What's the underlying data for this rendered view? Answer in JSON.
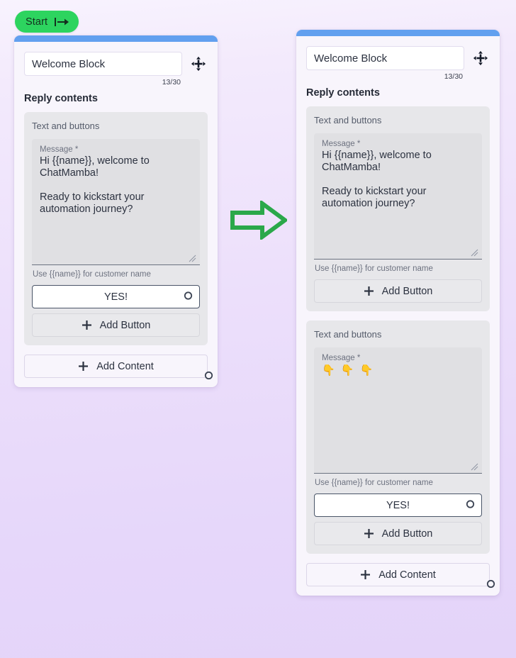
{
  "canvas": {
    "background_top": "#f8f3fe",
    "background_bottom": "#e4d4f9",
    "accent_blue": "#62a0ef",
    "accent_green": "#2dd45f"
  },
  "start_node": {
    "label": "Start",
    "icon": "flow-start-arrow-icon"
  },
  "flow_arrow": {
    "icon": "right-arrow-icon",
    "color": "#2aa84a"
  },
  "nodes": [
    {
      "id": "before",
      "title_value": "Welcome Block",
      "title_placeholder": "Block name",
      "char_count": "13/30",
      "section_title": "Reply contents",
      "move_icon": "move-handle-icon",
      "blocks": [
        {
          "block_title": "Text and buttons",
          "message_label": "Message *",
          "message_value": "Hi {{name}}, welcome to ChatMamba!\n\nReady to kickstart your automation journey?",
          "message_is_emoji": false,
          "helper_text": "Use {{name}} for customer name",
          "reply_buttons": [
            {
              "label": "YES!"
            }
          ],
          "add_button_label": "Add Button"
        }
      ],
      "add_content_label": "Add Content"
    },
    {
      "id": "after",
      "title_value": "Welcome Block",
      "title_placeholder": "Block name",
      "char_count": "13/30",
      "section_title": "Reply contents",
      "move_icon": "move-handle-icon",
      "blocks": [
        {
          "block_title": "Text and buttons",
          "message_label": "Message *",
          "message_value": "Hi {{name}}, welcome to ChatMamba!\n\nReady to kickstart your automation journey?",
          "message_is_emoji": false,
          "helper_text": "Use {{name}} for customer name",
          "reply_buttons": [],
          "add_button_label": "Add Button"
        },
        {
          "block_title": "Text and buttons",
          "message_label": "Message *",
          "message_value": "👇 👇 👇",
          "message_is_emoji": true,
          "helper_text": "Use {{name}} for customer name",
          "reply_buttons": [
            {
              "label": "YES!"
            }
          ],
          "add_button_label": "Add Button"
        }
      ],
      "add_content_label": "Add Content"
    }
  ]
}
